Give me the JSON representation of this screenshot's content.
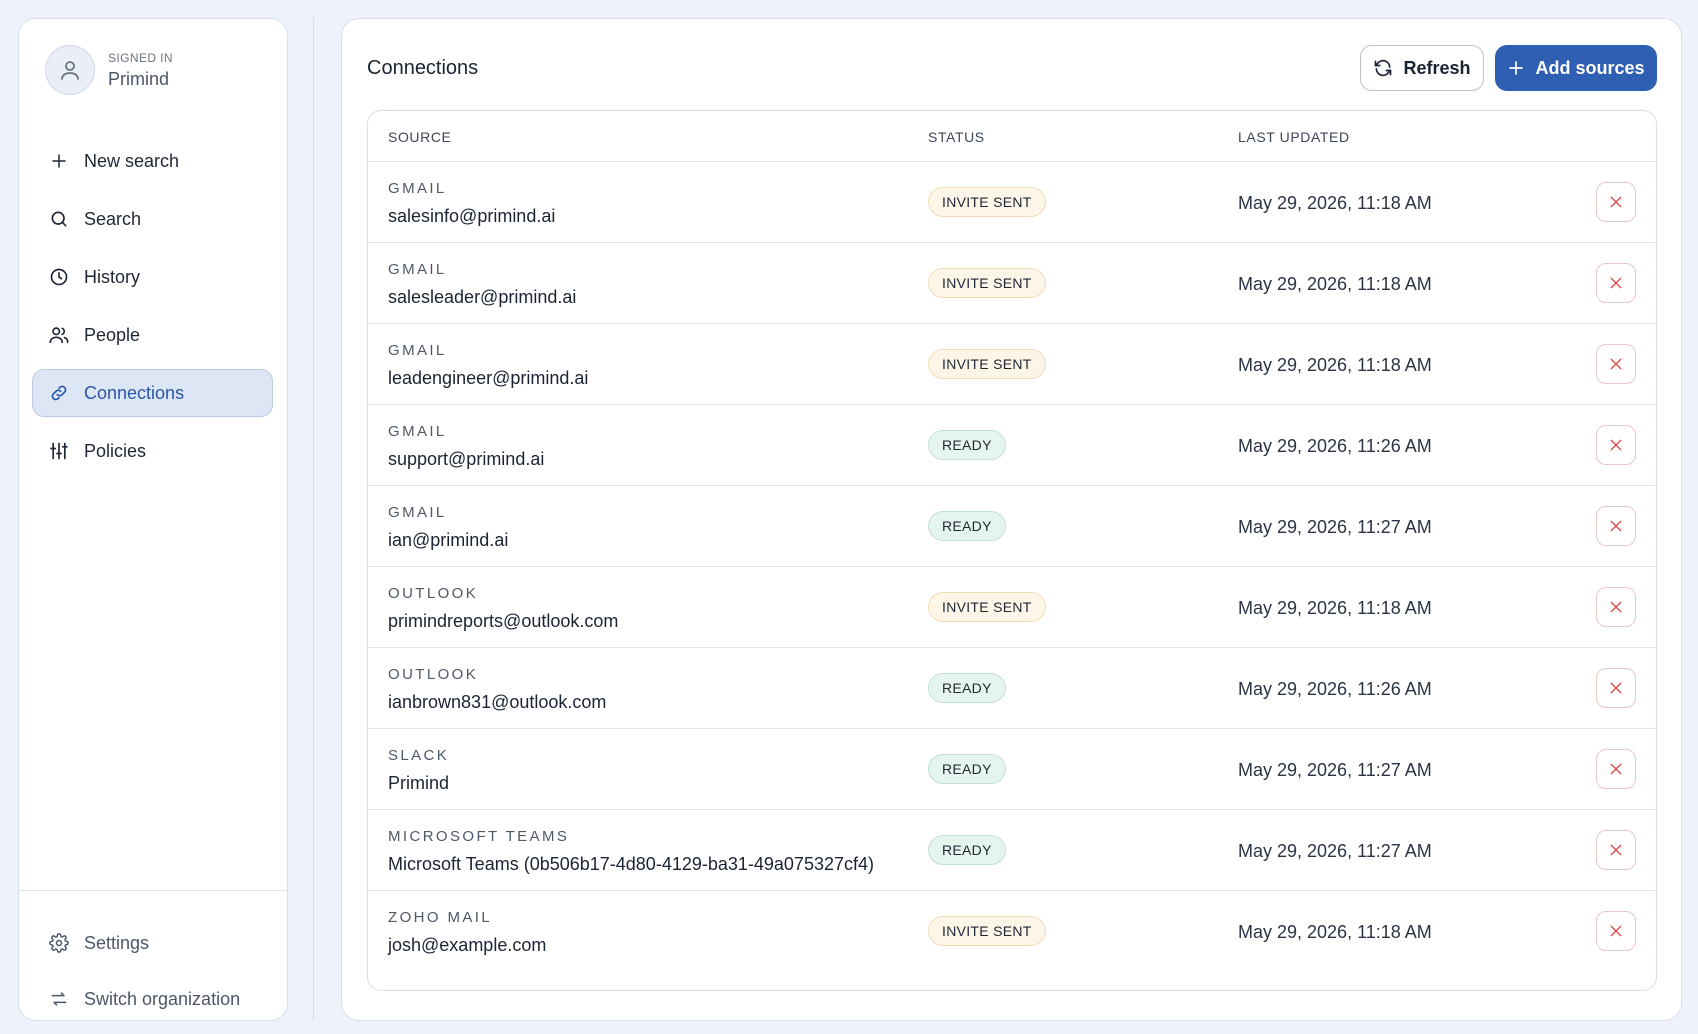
{
  "user": {
    "signed_in_label": "SIGNED IN",
    "name": "Primind"
  },
  "nav": [
    {
      "label": "New search",
      "icon": "plus-icon"
    },
    {
      "label": "Search",
      "icon": "search-icon"
    },
    {
      "label": "History",
      "icon": "clock-icon"
    },
    {
      "label": "People",
      "icon": "people-icon"
    },
    {
      "label": "Connections",
      "icon": "link-icon",
      "active": true
    },
    {
      "label": "Policies",
      "icon": "sliders-icon"
    }
  ],
  "bottom_nav": [
    {
      "label": "Settings",
      "icon": "gear-icon"
    },
    {
      "label": "Switch organization",
      "icon": "switch-icon"
    }
  ],
  "main": {
    "title": "Connections",
    "refresh_label": "Refresh",
    "add_label": "Add sources"
  },
  "table": {
    "headers": {
      "source": "SOURCE",
      "status": "STATUS",
      "last_updated": "LAST UPDATED"
    },
    "rows": [
      {
        "type": "GMAIL",
        "name": "salesinfo@primind.ai",
        "status": "INVITE SENT",
        "updated": "May 29, 2026, 11:18 AM"
      },
      {
        "type": "GMAIL",
        "name": "salesleader@primind.ai",
        "status": "INVITE SENT",
        "updated": "May 29, 2026, 11:18 AM"
      },
      {
        "type": "GMAIL",
        "name": "leadengineer@primind.ai",
        "status": "INVITE SENT",
        "updated": "May 29, 2026, 11:18 AM"
      },
      {
        "type": "GMAIL",
        "name": "support@primind.ai",
        "status": "READY",
        "updated": "May 29, 2026, 11:26 AM"
      },
      {
        "type": "GMAIL",
        "name": "ian@primind.ai",
        "status": "READY",
        "updated": "May 29, 2026, 11:27 AM"
      },
      {
        "type": "OUTLOOK",
        "name": "primindreports@outlook.com",
        "status": "INVITE SENT",
        "updated": "May 29, 2026, 11:18 AM"
      },
      {
        "type": "OUTLOOK",
        "name": "ianbrown831@outlook.com",
        "status": "READY",
        "updated": "May 29, 2026, 11:26 AM"
      },
      {
        "type": "SLACK",
        "name": "Primind",
        "status": "READY",
        "updated": "May 29, 2026, 11:27 AM"
      },
      {
        "type": "MICROSOFT TEAMS",
        "name": "Microsoft Teams (0b506b17-4d80-4129-ba31-49a075327cf4)",
        "status": "READY",
        "updated": "May 29, 2026, 11:27 AM"
      },
      {
        "type": "ZOHO MAIL",
        "name": "josh@example.com",
        "status": "INVITE SENT",
        "updated": "May 29, 2026, 11:18 AM"
      }
    ]
  },
  "colors": {
    "accent": "#2f5fb3",
    "active_nav_bg": "#dde6f4",
    "invite_badge_bg": "#fdf5e8",
    "ready_badge_bg": "#e6f4ee",
    "delete_icon": "#d9534f"
  }
}
